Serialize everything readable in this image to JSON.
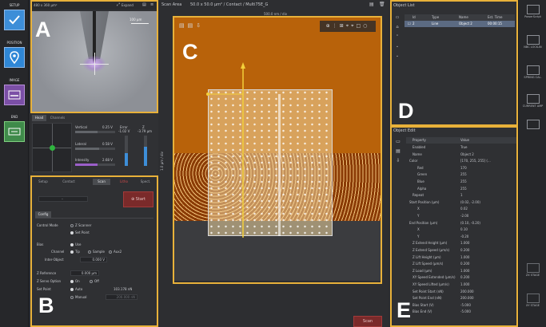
{
  "sidebar": {
    "items": [
      {
        "label": "SETUP",
        "icon": "check-icon",
        "color": "#3d8ed8"
      },
      {
        "label": "POSITION",
        "icon": "location-pin-icon",
        "color": "#2f87d6"
      },
      {
        "label": "IMAGE",
        "icon": "image-scan-icon",
        "color": "#7b4fa6"
      },
      {
        "label": "END",
        "icon": "end-icon",
        "color": "#3f8a4a"
      }
    ]
  },
  "video": {
    "size": "480 x 360 µm²",
    "expand_label": "Expand",
    "scale_label": "100 µm"
  },
  "head": {
    "tabs": [
      "Head",
      "Channels"
    ],
    "vertical_label": "Vertical",
    "vertical_value": "0.25 V",
    "lateral_label": "Lateral",
    "lateral_value": "0.58 V",
    "intensity_label": "Intensity",
    "intensity_value": "2.68 V",
    "error_label": "Error",
    "error_value": "-1.02 V",
    "z_label": "Z",
    "z_value": "-3.79 µm"
  },
  "control": {
    "tabs": [
      "Setup",
      "Contact",
      "Scan",
      "Litho",
      "Spect."
    ],
    "active_tab": "Scan",
    "dropdown_value": "-",
    "start_label": "Start",
    "config_label": "Config",
    "control_mode_label": "Control Mode",
    "control_mode_options": [
      "Z Scanner",
      "Set Point"
    ],
    "bias_label": "Bias",
    "use_label": "Use",
    "channel_label": "Channel",
    "channel_options": [
      "Tip",
      "Sample",
      "Aux2"
    ],
    "inter_object_label": "Inter-Object",
    "inter_object_value": "0.000 V",
    "z_reference_label": "Z Reference",
    "z_reference_value": "0.000 µm",
    "z_servo_label": "Z Servo Option",
    "z_servo_options": [
      "On",
      "Off"
    ],
    "set_point_label": "Set Point",
    "set_point_options": [
      "Auto",
      "Manual"
    ],
    "set_point_value": "103.178 nN",
    "manual_value": "200.000 nN"
  },
  "scan": {
    "title": "Scan Area",
    "info": "50.0 x 50.0 µm² / Contact / Multi75E_G",
    "x_scale": "500.0 nm / div",
    "y_scale": "1.0 µm / div",
    "bottom_scan_label": "Scan"
  },
  "object_list": {
    "title": "Object List",
    "headers": [
      "Id",
      "Type",
      "Name",
      "Est. Time"
    ],
    "rows": [
      {
        "id": "2",
        "type": "Line",
        "name": "Object 2",
        "time": "00:00:15"
      }
    ]
  },
  "object_edit": {
    "title": "Object Edit",
    "headers": [
      "Property",
      "Value"
    ],
    "rows": [
      {
        "p": "Enabled",
        "v": "True",
        "indent": 1
      },
      {
        "p": "Name",
        "v": "Object 2",
        "indent": 1
      },
      {
        "p": "Color",
        "v": "[170, 255, 255] (...",
        "indent": 0
      },
      {
        "p": "Red",
        "v": "170",
        "indent": 2
      },
      {
        "p": "Green",
        "v": "255",
        "indent": 2
      },
      {
        "p": "Blue",
        "v": "255",
        "indent": 2
      },
      {
        "p": "Alpha",
        "v": "255",
        "indent": 2
      },
      {
        "p": "Repeat",
        "v": "1",
        "indent": 1
      },
      {
        "p": "Start Position (µm)",
        "v": "(0.02, -2.00)",
        "indent": 0
      },
      {
        "p": "X",
        "v": "0.02",
        "indent": 2
      },
      {
        "p": "Y",
        "v": "-2.00",
        "indent": 2
      },
      {
        "p": "End Position (µm)",
        "v": "(0.10, -0.20)",
        "indent": 0
      },
      {
        "p": "X",
        "v": "0.10",
        "indent": 2
      },
      {
        "p": "Y",
        "v": "-0.20",
        "indent": 2
      },
      {
        "p": "Z Extend Height (µm)",
        "v": "1.000",
        "indent": 1
      },
      {
        "p": "Z Extend Speed (µm/s)",
        "v": "0.200",
        "indent": 1
      },
      {
        "p": "Z Lift Height (µm)",
        "v": "1.000",
        "indent": 1
      },
      {
        "p": "Z Lift Speed (µm/s)",
        "v": "0.200",
        "indent": 1
      },
      {
        "p": "Z Load (µm)",
        "v": "1.000",
        "indent": 1
      },
      {
        "p": "XY Speed Extended (µm/s)",
        "v": "0.200",
        "indent": 1
      },
      {
        "p": "XY Speed Lifted (µm/s)",
        "v": "1.000",
        "indent": 1
      },
      {
        "p": "Set Point Start (nN)",
        "v": "200.000",
        "indent": 1
      },
      {
        "p": "Set Point End (nN)",
        "v": "200.000",
        "indent": 1
      },
      {
        "p": "Bias Start (V)",
        "v": "-5.000",
        "indent": 1
      },
      {
        "p": "Bias End (V)",
        "v": "-5.000",
        "indent": 1
      }
    ]
  },
  "right_bar": {
    "items": [
      "PowerScript",
      "NBC LOCK-IN",
      "SPRING CAL.",
      "CURRENT AMP",
      "ZX STAGE",
      "XY STAGE"
    ]
  },
  "panel_labels": [
    "A",
    "B",
    "C",
    "D",
    "E"
  ]
}
